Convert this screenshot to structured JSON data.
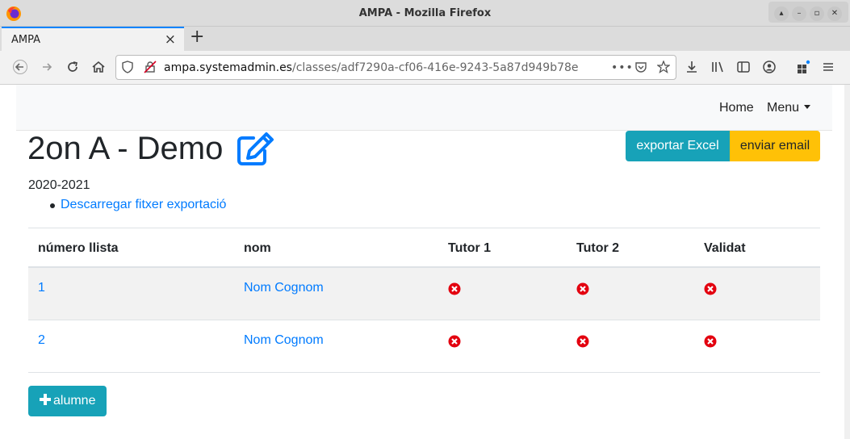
{
  "window": {
    "title": "AMPA - Mozilla Firefox",
    "controls": [
      "restore-up-icon",
      "minimize-icon",
      "maximize-icon",
      "close-icon"
    ]
  },
  "tabs": [
    {
      "label": "AMPA",
      "close": "×",
      "active": true
    }
  ],
  "new_tab": "+",
  "url": {
    "host": "ampa.systemadmin.es",
    "path": "/classes/adf7290a-cf06-416e-9243-5a87d949b78e",
    "more": "•••"
  },
  "site_nav": {
    "home": "Home",
    "menu": "Menu"
  },
  "page": {
    "title": "2on A - Demo",
    "export_button": "exportar Excel",
    "email_button": "enviar email",
    "year": "2020-2021",
    "download_link": "Descarregar fitxer exportació",
    "add_button": "alumne"
  },
  "table": {
    "headers": [
      "número llista",
      "nom",
      "Tutor 1",
      "Tutor 2",
      "Validat"
    ],
    "rows": [
      {
        "num": "1",
        "name": "Nom Cognom",
        "tutor1": "x-circle-icon",
        "tutor2": "x-circle-icon",
        "validat": "x-circle-icon"
      },
      {
        "num": "2",
        "name": "Nom Cognom",
        "tutor1": "x-circle-icon",
        "tutor2": "x-circle-icon",
        "validat": "x-circle-icon"
      }
    ]
  },
  "colors": {
    "link": "#007bff",
    "info": "#17a2b8",
    "warning": "#ffc107",
    "danger": "#e3000f",
    "firefox_accent": "#0a84ff"
  }
}
